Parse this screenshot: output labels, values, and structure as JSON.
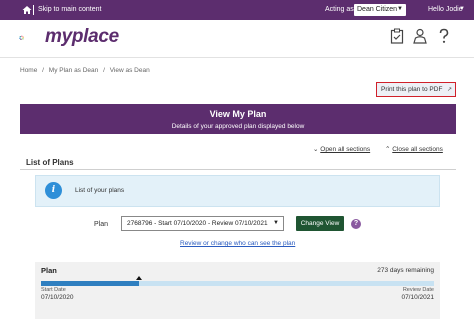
{
  "topbar": {
    "skip_label": "Skip to main content",
    "acting_as_label": "Acting as",
    "acting_as_value": "Dean Citizen",
    "greeting": "Hello Jodie"
  },
  "header": {
    "logo_text": "myplace",
    "icons": [
      "clipboard-icon",
      "person-icon",
      "help-icon"
    ]
  },
  "breadcrumb": [
    "Home",
    "/",
    "My Plan as Dean",
    "/",
    "View as Dean"
  ],
  "print_button": "Print this plan to PDF",
  "banner": {
    "title": "View My Plan",
    "subtitle": "Details of your approved plan displayed below"
  },
  "sections": {
    "open_all": "Open all sections",
    "close_all": "Close all sections"
  },
  "list_title": "List of Plans",
  "info_text": "List of your plans",
  "plan_select": {
    "label": "Plan",
    "value": "2768796 - Start 07/10/2020 - Review 07/10/2021"
  },
  "change_view_button": "Change View",
  "review_link": "Review or change who can see the plan",
  "plan_card": {
    "name": "Plan",
    "remaining": "273 days remaining",
    "start_label": "Start Date",
    "start_date": "07/10/2020",
    "review_label": "Review Date",
    "review_date": "07/10/2021",
    "progress": 0.25
  },
  "colors": {
    "brand_purple": "#5c2d6e",
    "button_green": "#1f5532",
    "info_blue": "#2f8fd8",
    "highlight_red": "#d0202a"
  }
}
